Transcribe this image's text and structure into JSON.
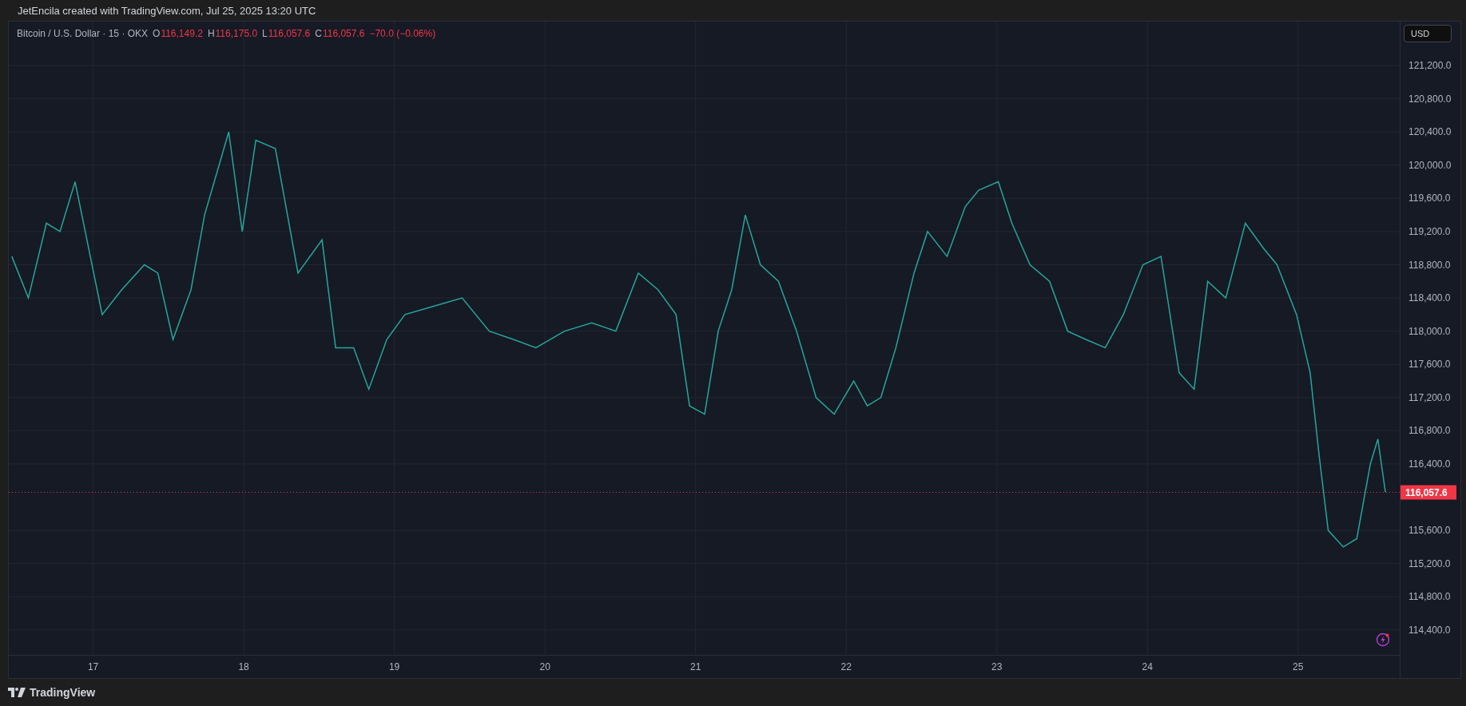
{
  "header": {
    "caption": "JetEncila created with TradingView.com, Jul 25, 2025 13:20 UTC"
  },
  "legend": {
    "symbol": "Bitcoin / U.S. Dollar · 15 · OKX",
    "fields": [
      {
        "label": "O",
        "value": "116,149.2"
      },
      {
        "label": "H",
        "value": "116,175.0"
      },
      {
        "label": "L",
        "value": "116,057.6"
      },
      {
        "label": "C",
        "value": "116,057.6"
      }
    ],
    "change": "−70.0 (−0.06%)"
  },
  "currency_button": "USD",
  "chart_data": {
    "type": "line",
    "x": [
      16.46,
      16.57,
      16.69,
      16.78,
      16.88,
      16.97,
      17.06,
      17.19,
      17.34,
      17.43,
      17.53,
      17.65,
      17.74,
      17.9,
      17.99,
      18.08,
      18.21,
      18.3,
      18.36,
      18.52,
      18.61,
      18.73,
      18.83,
      18.95,
      19.07,
      19.26,
      19.45,
      19.63,
      19.79,
      19.94,
      20.13,
      20.31,
      20.47,
      20.62,
      20.75,
      20.87,
      20.96,
      21.06,
      21.15,
      21.24,
      21.33,
      21.43,
      21.55,
      21.67,
      21.8,
      21.92,
      22.05,
      22.14,
      22.23,
      22.33,
      22.45,
      22.54,
      22.67,
      22.79,
      22.88,
      23.01,
      23.1,
      23.22,
      23.35,
      23.47,
      23.59,
      23.72,
      23.84,
      23.97,
      24.09,
      24.21,
      24.31,
      24.4,
      24.52,
      24.65,
      24.77,
      24.86,
      24.99,
      25.08,
      25.14,
      25.2,
      25.3,
      25.39,
      25.48,
      25.53,
      25.58
    ],
    "series": [
      {
        "color": "#26a69a",
        "values": [
          118900,
          118400,
          119300,
          119200,
          119800,
          119000,
          118200,
          118500,
          118800,
          118700,
          117900,
          118500,
          119400,
          120400,
          119200,
          120300,
          120200,
          119300,
          118700,
          119100,
          117800,
          117800,
          117300,
          117900,
          118200,
          118300,
          118400,
          118000,
          117900,
          117800,
          118000,
          118100,
          118000,
          118700,
          118500,
          118200,
          117100,
          117000,
          118000,
          118500,
          119400,
          118800,
          118600,
          118000,
          117200,
          117000,
          117400,
          117100,
          117200,
          117800,
          118700,
          119200,
          118900,
          119500,
          119700,
          119800,
          119300,
          118800,
          118600,
          118000,
          117900,
          117800,
          118200,
          118800,
          118900,
          117500,
          117300,
          118600,
          118400,
          119300,
          119000,
          118800,
          118200,
          117500,
          116500,
          115600,
          115400,
          115500,
          116400,
          116700,
          116060
        ]
      }
    ],
    "xlim": [
      16.44,
      25.68
    ],
    "ylim": [
      114090,
      121730
    ],
    "xticks": [
      {
        "value": 17,
        "label": "17"
      },
      {
        "value": 18,
        "label": "18"
      },
      {
        "value": 19,
        "label": "19"
      },
      {
        "value": 20,
        "label": "20"
      },
      {
        "value": 21,
        "label": "21"
      },
      {
        "value": 22,
        "label": "22"
      },
      {
        "value": 23,
        "label": "23"
      },
      {
        "value": 24,
        "label": "24"
      },
      {
        "value": 25,
        "label": "25"
      }
    ],
    "yticks": [
      {
        "value": 114400,
        "label": "114,400.0"
      },
      {
        "value": 114800,
        "label": "114,800.0"
      },
      {
        "value": 115200,
        "label": "115,200.0"
      },
      {
        "value": 115600,
        "label": "115,600.0"
      },
      {
        "value": 116400,
        "label": "116,400.0"
      },
      {
        "value": 116800,
        "label": "116,800.0"
      },
      {
        "value": 117200,
        "label": "117,200.0"
      },
      {
        "value": 117600,
        "label": "117,600.0"
      },
      {
        "value": 118000,
        "label": "118,000.0"
      },
      {
        "value": 118400,
        "label": "118,400.0"
      },
      {
        "value": 118800,
        "label": "118,800.0"
      },
      {
        "value": 119200,
        "label": "119,200.0"
      },
      {
        "value": 119600,
        "label": "119,600.0"
      },
      {
        "value": 120000,
        "label": "120,000.0"
      },
      {
        "value": 120400,
        "label": "120,400.0"
      },
      {
        "value": 120800,
        "label": "120,800.0"
      },
      {
        "value": 121200,
        "label": "121,200.0"
      }
    ],
    "grid": true,
    "ref_lines": [
      {
        "axis": "y",
        "value": 116057.6,
        "label": "116,057.6",
        "color": "#f23645"
      }
    ]
  },
  "footer": {
    "logo_text": "TradingView"
  }
}
